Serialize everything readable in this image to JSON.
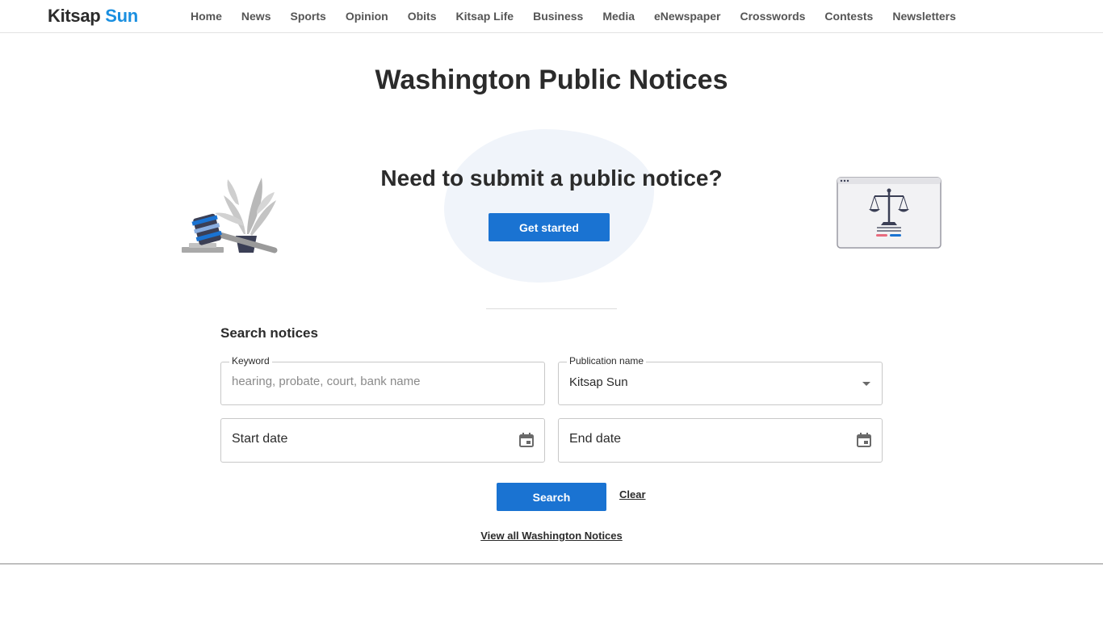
{
  "brand": {
    "part1": "Kitsap",
    "part2": "Sun"
  },
  "nav": [
    "Home",
    "News",
    "Sports",
    "Opinion",
    "Obits",
    "Kitsap Life",
    "Business",
    "Media",
    "eNewspaper",
    "Crosswords",
    "Contests",
    "Newsletters"
  ],
  "page": {
    "title": "Washington Public Notices"
  },
  "hero": {
    "heading": "Need to submit a public notice?",
    "button": "Get started"
  },
  "search": {
    "heading": "Search notices",
    "keyword": {
      "label": "Keyword",
      "placeholder": "hearing, probate, court, bank name"
    },
    "publication": {
      "label": "Publication name",
      "value": "Kitsap Sun"
    },
    "start_date": {
      "value": "Start date"
    },
    "end_date": {
      "value": "End date"
    },
    "search_button": "Search",
    "clear_link": "Clear",
    "view_all": "View all Washington Notices"
  },
  "colors": {
    "accent": "#1a73d2",
    "brand_blue": "#1a8fe0",
    "text": "#2b2b2b",
    "blob": "#f0f4fa"
  },
  "icons": [
    "gavel-plant-illustration",
    "scales-of-justice-illustration",
    "calendar-icon",
    "chevron-down-icon"
  ]
}
